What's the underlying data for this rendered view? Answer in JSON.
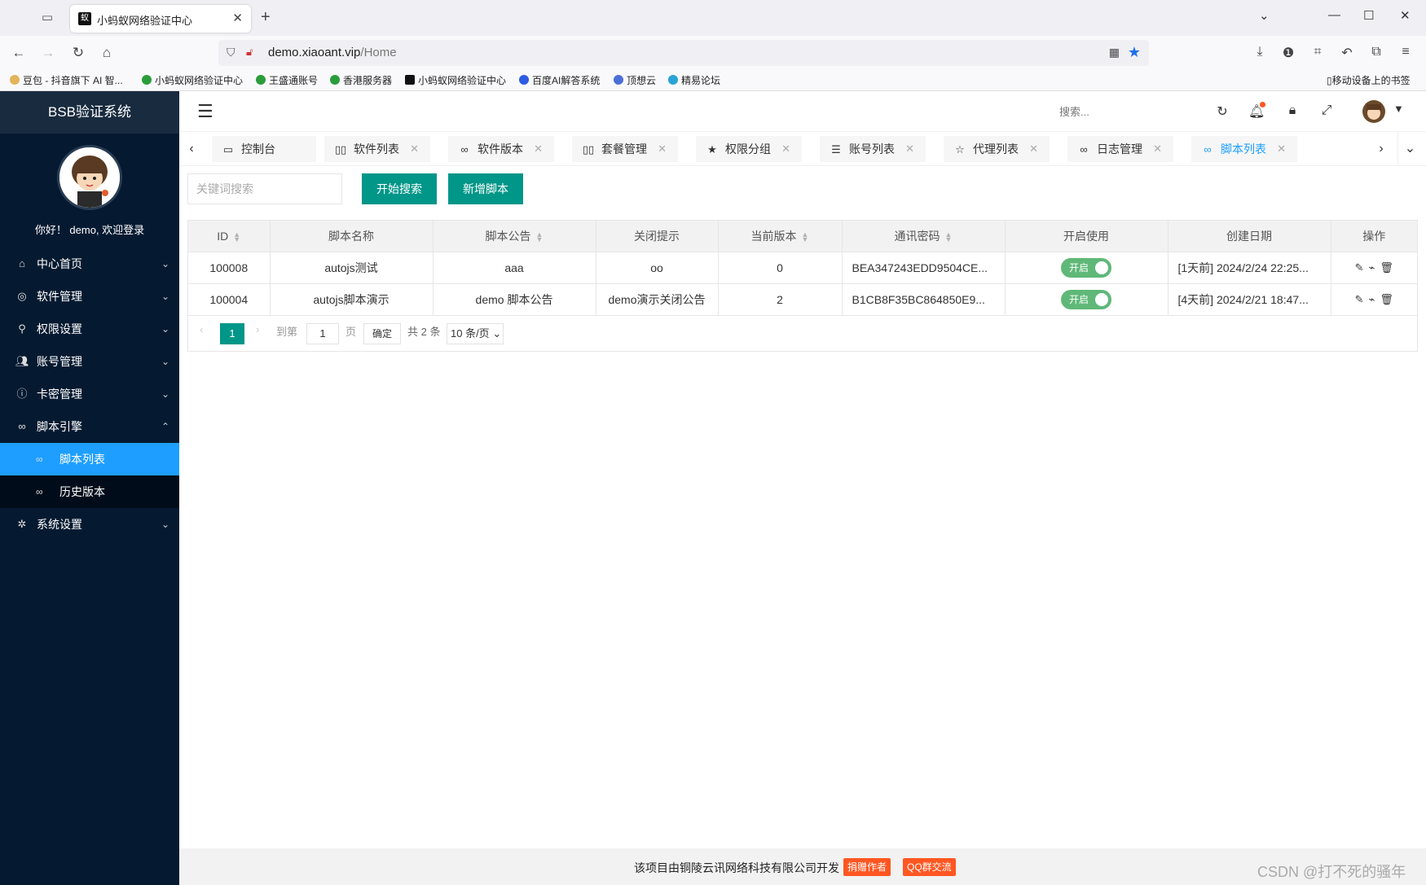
{
  "browser": {
    "tab_title": "小蚂蚁网络验证中心",
    "url_domain": "demo.xiaoant.vip",
    "url_path": "/Home",
    "bookmarks": [
      "豆包 - 抖音旗下 AI 智...",
      "小蚂蚁网络验证中心",
      "王盛通账号",
      "香港服务器",
      "小蚂蚁网络验证中心",
      "百度AI解答系统",
      "顶想云",
      "精易论坛"
    ],
    "mobile_bookmarks": "移动设备上的书签"
  },
  "app": {
    "title": "BSB验证系统",
    "welcome": "你好！ demo, 欢迎登录",
    "search_placeholder": "搜索..."
  },
  "sidebar": {
    "items": [
      {
        "label": "中心首页",
        "icon": "home-icon"
      },
      {
        "label": "软件管理",
        "icon": "software-icon"
      },
      {
        "label": "权限设置",
        "icon": "permission-icon"
      },
      {
        "label": "账号管理",
        "icon": "users-icon"
      },
      {
        "label": "卡密管理",
        "icon": "card-icon"
      },
      {
        "label": "脚本引擎",
        "icon": "script-icon"
      }
    ],
    "sub_items": [
      "脚本列表",
      "历史版本"
    ],
    "last_item": "系统设置"
  },
  "page_tabs": [
    {
      "label": "控制台",
      "icon": "monitor-icon"
    },
    {
      "label": "软件列表",
      "icon": "columns-icon"
    },
    {
      "label": "软件版本",
      "icon": "link-icon"
    },
    {
      "label": "套餐管理",
      "icon": "columns-icon"
    },
    {
      "label": "权限分组",
      "icon": "star-icon"
    },
    {
      "label": "账号列表",
      "icon": "list-icon"
    },
    {
      "label": "代理列表",
      "icon": "star-outline-icon"
    },
    {
      "label": "日志管理",
      "icon": "link-icon"
    },
    {
      "label": "脚本列表",
      "icon": "link-icon",
      "active": true
    }
  ],
  "toolbar": {
    "keyword_placeholder": "关键词搜索",
    "search_button": "开始搜索",
    "add_button": "新增脚本"
  },
  "table": {
    "columns": [
      "ID",
      "脚本名称",
      "脚本公告",
      "关闭提示",
      "当前版本",
      "通讯密码",
      "开启使用",
      "创建日期",
      "操作"
    ],
    "rows": [
      {
        "id": "100008",
        "name": "autojs测试",
        "notice": "aaa",
        "close_tip": "oo",
        "version": "0",
        "password": "BEA347243EDD9504CE...",
        "enabled": "开启",
        "created": "[1天前] 2024/2/24 22:25..."
      },
      {
        "id": "100004",
        "name": "autojs脚本演示",
        "notice": "demo 脚本公告",
        "close_tip": "demo演示关闭公告",
        "version": "2",
        "password": "B1CB8F35BC864850E9...",
        "enabled": "开启",
        "created": "[4天前] 2024/2/21 18:47..."
      }
    ]
  },
  "pager": {
    "current": "1",
    "goto_label": "到第",
    "goto_value": "1",
    "page_unit": "页",
    "confirm": "确定",
    "total": "共 2 条",
    "page_size": "10 条/页"
  },
  "footer": {
    "text": "该项目由铜陵云讯网络科技有限公司开发",
    "donate": "捐赠作者",
    "qq": "QQ群交流",
    "watermark": "CSDN @打不死的骚年"
  },
  "colors": {
    "sidebar_bg": "#051a31",
    "accent": "#1e9fff",
    "primary_btn": "#009688",
    "switch_on": "#5fb878",
    "badge": "#ff5722"
  }
}
